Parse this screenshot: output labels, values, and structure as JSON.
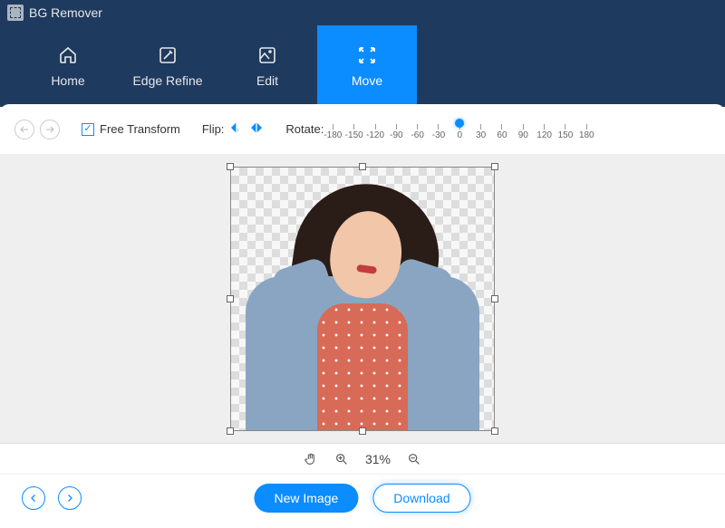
{
  "app": {
    "title": "BG Remover"
  },
  "tabs": {
    "items": [
      {
        "label": "Home"
      },
      {
        "label": "Edge Refine"
      },
      {
        "label": "Edit"
      },
      {
        "label": "Move"
      }
    ],
    "active_index": 3
  },
  "toolbar": {
    "free_transform_label": "Free Transform",
    "free_transform_checked": true,
    "flip_label": "Flip:",
    "rotate_label": "Rotate:",
    "rotate_ticks": [
      "-180",
      "-150",
      "-120",
      "-90",
      "-60",
      "-30",
      "0",
      "30",
      "60",
      "90",
      "120",
      "150",
      "180"
    ],
    "rotate_value": 0
  },
  "zoom": {
    "value_text": "31%"
  },
  "footer": {
    "new_image_label": "New Image",
    "download_label": "Download"
  }
}
